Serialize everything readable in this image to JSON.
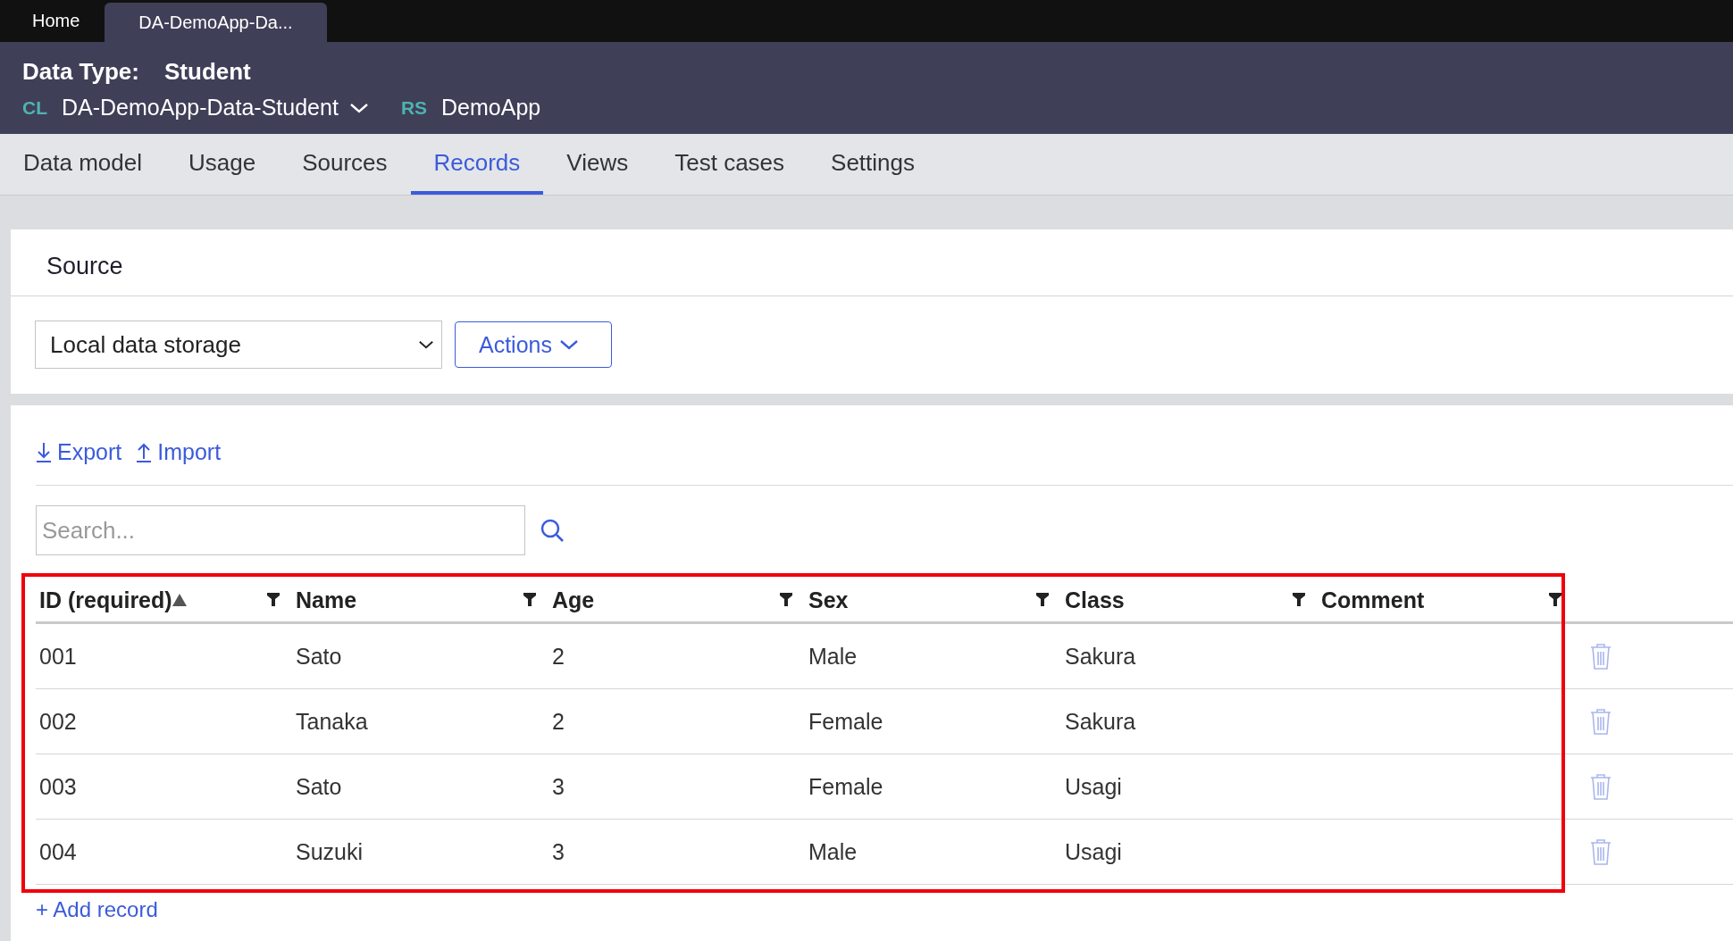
{
  "top_tabs": [
    {
      "label": "Home",
      "selected": false
    },
    {
      "label": "DA-DemoApp-Da...",
      "selected": true
    }
  ],
  "header": {
    "title_label": "Data Type:",
    "title_value": "Student",
    "class_badge": "CL",
    "class_name": "DA-DemoApp-Data-Student",
    "ruleset_badge": "RS",
    "ruleset_name": "DemoApp"
  },
  "tabs": [
    {
      "label": "Data model",
      "selected": false
    },
    {
      "label": "Usage",
      "selected": false
    },
    {
      "label": "Sources",
      "selected": false
    },
    {
      "label": "Records",
      "selected": true
    },
    {
      "label": "Views",
      "selected": false
    },
    {
      "label": "Test cases",
      "selected": false
    },
    {
      "label": "Settings",
      "selected": false
    }
  ],
  "source": {
    "title": "Source",
    "select_value": "Local data storage",
    "actions_button": "Actions"
  },
  "records": {
    "export": "Export",
    "import": "Import",
    "search": {
      "placeholder": "Search..."
    },
    "table": {
      "highlighted": true,
      "columns": [
        {
          "label": "ID (required)",
          "sorted": true
        },
        {
          "label": "Name",
          "sorted": false
        },
        {
          "label": "Age",
          "sorted": false
        },
        {
          "label": "Sex",
          "sorted": false
        },
        {
          "label": "Class",
          "sorted": false
        },
        {
          "label": "Comment",
          "sorted": false
        }
      ],
      "rows": [
        [
          "001",
          "Sato",
          "2",
          "Male",
          "Sakura"
        ],
        [
          "002",
          "Tanaka",
          "2",
          "Female",
          "Sakura"
        ],
        [
          "003",
          "Sato",
          "3",
          "Female",
          "Usagi"
        ],
        [
          "004",
          "Suzuki",
          "3",
          "Male",
          "Usagi"
        ]
      ]
    },
    "add_record": "+ Add record"
  }
}
